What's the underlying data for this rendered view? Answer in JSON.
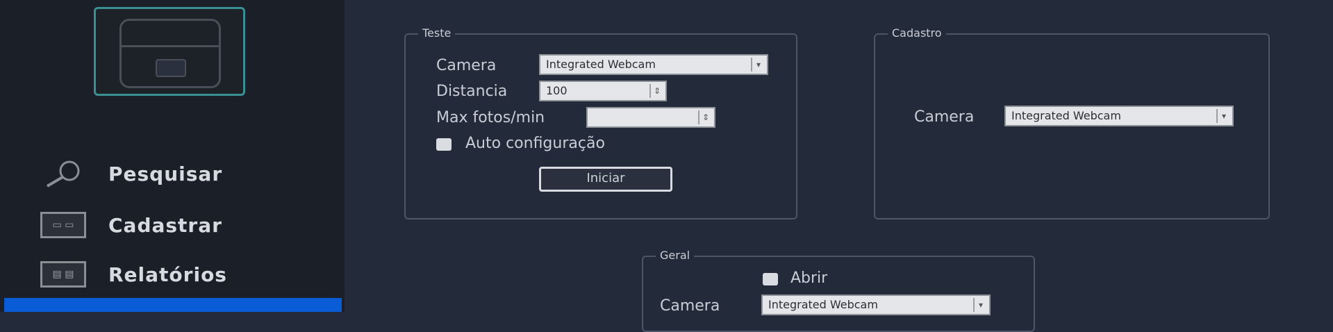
{
  "sidebar": {
    "logo": {
      "icon": "device-icon"
    },
    "items": [
      {
        "label": "Pesquisar",
        "icon": "search-icon"
      },
      {
        "label": "Cadastrar",
        "icon": "register-icon"
      },
      {
        "label": "Relatórios",
        "icon": "reports-icon"
      }
    ],
    "active_color": "#0a5bd6"
  },
  "teste": {
    "title": "Teste",
    "camera_label": "Camera",
    "camera_value": "Integrated Webcam",
    "distancia_label": "Distancia",
    "distancia_value": "100",
    "max_label": "Max fotos/min",
    "max_value": "",
    "auto_label": "Auto configuração",
    "button_label": "Iniciar"
  },
  "cadastro": {
    "title": "Cadastro",
    "camera_label": "Camera",
    "camera_value": "Integrated Webcam"
  },
  "geral": {
    "title": "Geral",
    "check_label": "Abrir",
    "camera_label": "Camera",
    "camera_value": "Integrated Webcam"
  }
}
